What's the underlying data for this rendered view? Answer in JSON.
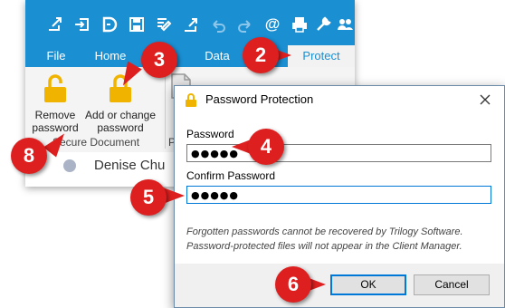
{
  "app": {
    "tabs": [
      "File",
      "Home",
      "Data",
      "Protect"
    ],
    "active_tab": "Protect",
    "ribbon": {
      "remove_password": [
        "Remove",
        "password"
      ],
      "add_change_password": [
        "Add or change",
        "password"
      ],
      "group_label": "Secure Document",
      "cut_group_label": "P"
    },
    "document": {
      "person_name": "Denise Chu"
    }
  },
  "dialog": {
    "title": "Password Protection",
    "password_label": "Password",
    "password_value": "●●●●●",
    "confirm_label": "Confirm Password",
    "confirm_value": "●●●●●",
    "note_line1": "Forgotten passwords cannot be recovered by Trilogy Software.",
    "note_line2": "Password-protected files will not appear in the Client Manager.",
    "ok_label": "OK",
    "cancel_label": "Cancel"
  },
  "callouts": [
    "2",
    "3",
    "4",
    "5",
    "6",
    "8"
  ],
  "colors": {
    "brand_blue": "#1a8fd2",
    "marker_red": "#dd1f1f",
    "lock_gold": "#f0b400",
    "focus_blue": "#0078d7"
  }
}
